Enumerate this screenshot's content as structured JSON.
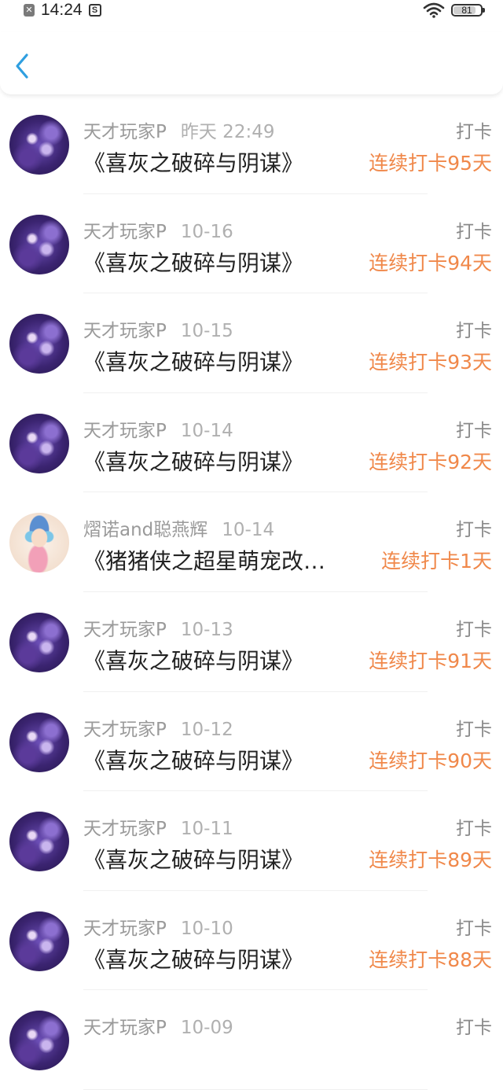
{
  "status_bar": {
    "notification_icon": "close-box-icon",
    "time": "14:24",
    "sync_icon": "s-box-icon",
    "wifi_icon": "wifi-icon",
    "battery_level": "81"
  },
  "header": {
    "back_icon": "chevron-left-icon",
    "accent_color": "#2f9fe0"
  },
  "colors": {
    "streak": "#f0884a",
    "username": "#9a9a9a",
    "title": "#222222"
  },
  "feed": [
    {
      "user": "天才玩家P",
      "time": "昨天 22:49",
      "action": "打卡",
      "title": "《喜灰之破碎与阴谋》",
      "streak": "连续打卡95天",
      "avatar": "purple"
    },
    {
      "user": "天才玩家P",
      "time": "10-16",
      "action": "打卡",
      "title": "《喜灰之破碎与阴谋》",
      "streak": "连续打卡94天",
      "avatar": "purple"
    },
    {
      "user": "天才玩家P",
      "time": "10-15",
      "action": "打卡",
      "title": "《喜灰之破碎与阴谋》",
      "streak": "连续打卡93天",
      "avatar": "purple"
    },
    {
      "user": "天才玩家P",
      "time": "10-14",
      "action": "打卡",
      "title": "《喜灰之破碎与阴谋》",
      "streak": "连续打卡92天",
      "avatar": "purple"
    },
    {
      "user": "熠诺and聪燕辉",
      "time": "10-14",
      "action": "打卡",
      "title": "《猪猪侠之超星萌宠改…",
      "streak": "连续打卡1天",
      "avatar": "cartoon"
    },
    {
      "user": "天才玩家P",
      "time": "10-13",
      "action": "打卡",
      "title": "《喜灰之破碎与阴谋》",
      "streak": "连续打卡91天",
      "avatar": "purple"
    },
    {
      "user": "天才玩家P",
      "time": "10-12",
      "action": "打卡",
      "title": "《喜灰之破碎与阴谋》",
      "streak": "连续打卡90天",
      "avatar": "purple"
    },
    {
      "user": "天才玩家P",
      "time": "10-11",
      "action": "打卡",
      "title": "《喜灰之破碎与阴谋》",
      "streak": "连续打卡89天",
      "avatar": "purple"
    },
    {
      "user": "天才玩家P",
      "time": "10-10",
      "action": "打卡",
      "title": "《喜灰之破碎与阴谋》",
      "streak": "连续打卡88天",
      "avatar": "purple"
    },
    {
      "user": "天才玩家P",
      "time": "10-09",
      "action": "打卡",
      "title": "",
      "streak": "",
      "avatar": "purple"
    }
  ]
}
